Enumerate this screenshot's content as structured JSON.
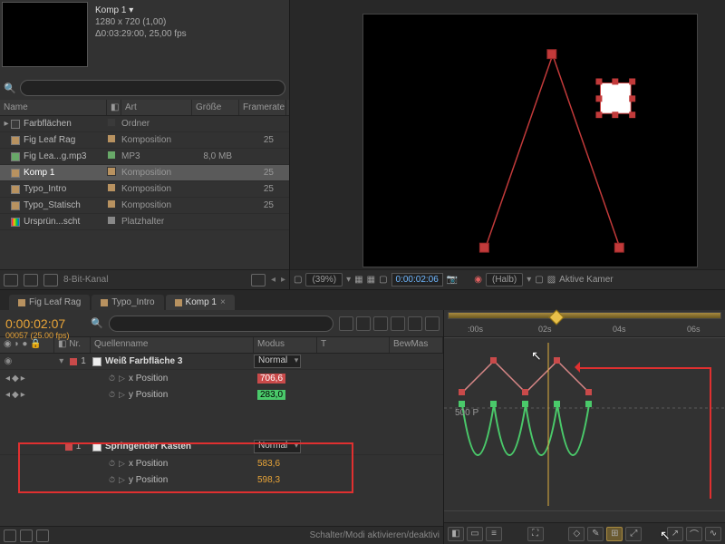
{
  "project": {
    "comp_name": "Komp 1 ▾",
    "dimensions": "1280 x 720 (1,00)",
    "duration": "Δ0:03:29:00, 25,00 fps",
    "search_placeholder": "",
    "columns": {
      "name": "Name",
      "art": "Art",
      "size": "Größe",
      "fps": "Framerate"
    },
    "items": [
      {
        "name": "Farbflächen",
        "art": "Ordner",
        "size": "",
        "fps": "",
        "color": "#3a3a3a",
        "twist": "▸"
      },
      {
        "name": "Fig Leaf Rag",
        "art": "Komposition",
        "size": "",
        "fps": "25",
        "color": "#b89260"
      },
      {
        "name": "Fig Lea...g.mp3",
        "art": "MP3",
        "size": "8,0 MB",
        "fps": "",
        "color": "#68a868"
      },
      {
        "name": "Komp 1",
        "art": "Komposition",
        "size": "",
        "fps": "25",
        "color": "#b89260",
        "sel": true
      },
      {
        "name": "Typo_Intro",
        "art": "Komposition",
        "size": "",
        "fps": "25",
        "color": "#b89260"
      },
      {
        "name": "Typo_Statisch",
        "art": "Komposition",
        "size": "",
        "fps": "25",
        "color": "#b89260"
      },
      {
        "name": "Ursprün...scht",
        "art": "Platzhalter",
        "size": "",
        "fps": "",
        "color": "rainbow"
      }
    ],
    "footer": {
      "bit": "8-Bit-Kanal"
    }
  },
  "preview": {
    "zoom": "(39%)",
    "timecode": "0:00:02:06",
    "quality": "(Halb)",
    "camera": "Aktive Kamer"
  },
  "timeline": {
    "tabs": [
      "Fig Leaf Rag",
      "Typo_Intro",
      "Komp 1"
    ],
    "active_tab": 2,
    "timecode": "0:00:02:07",
    "frame_info": "00057 (25.00 fps)",
    "headers": {
      "nr": "Nr.",
      "source": "Quellenname",
      "mode": "Modus",
      "t": "T",
      "trkmat": "BewMas"
    },
    "layer1": {
      "nr": "1",
      "name": "Weiß Farbfläche 3",
      "mode": "Normal",
      "xpos_label": "x Position",
      "xpos_val": "706,6",
      "ypos_label": "y Position",
      "ypos_val": "283,0"
    },
    "layer2": {
      "nr": "1",
      "name": "Springender Kasten",
      "mode": "Normal",
      "xpos_label": "x Position",
      "xpos_val": "583,6",
      "ypos_label": "y Position",
      "ypos_val": "598,3"
    },
    "footer_hint": "Schalter/Modi aktivieren/deaktivi",
    "ruler": {
      "t0": ":00s",
      "t1": "02s",
      "t2": "04s",
      "t3": "06s"
    },
    "graph_label": "500 P"
  }
}
